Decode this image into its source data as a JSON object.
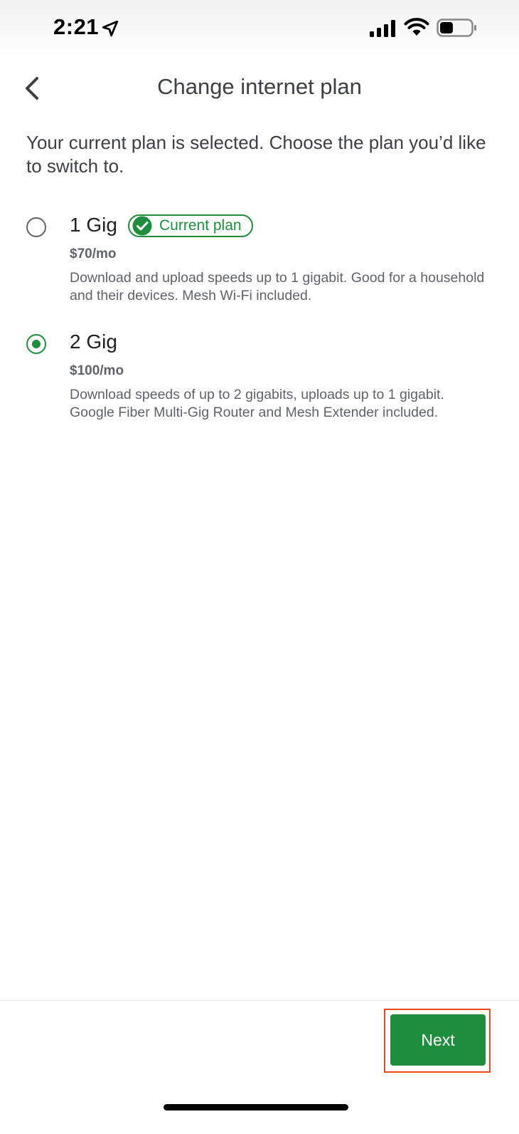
{
  "status_bar": {
    "time": "2:21",
    "icons": [
      "location-arrow-icon",
      "cellular-signal-icon",
      "wifi-icon",
      "battery-icon"
    ]
  },
  "header": {
    "back_icon": "chevron-left-icon",
    "title": "Change internet plan"
  },
  "intro": "Your current plan is selected. Choose the plan you’d like to switch to.",
  "plans": [
    {
      "name": "1 Gig",
      "badge": "Current plan",
      "price": "$70/mo",
      "description": "Download and upload speeds up to 1 gigabit. Good for a household and their devices. Mesh Wi-Fi included.",
      "selected": false
    },
    {
      "name": "2 Gig",
      "price": "$100/mo",
      "description": "Download speeds of up to 2 gigabits, uploads up to 1 gigabit. Google Fiber Multi-Gig Router and Mesh Extender included.",
      "selected": true
    }
  ],
  "footer": {
    "next_label": "Next"
  },
  "colors": {
    "accent_green": "#1e8e3e",
    "highlight_outline": "#e8481f",
    "text_primary": "#202124",
    "text_secondary": "#5f6368"
  }
}
